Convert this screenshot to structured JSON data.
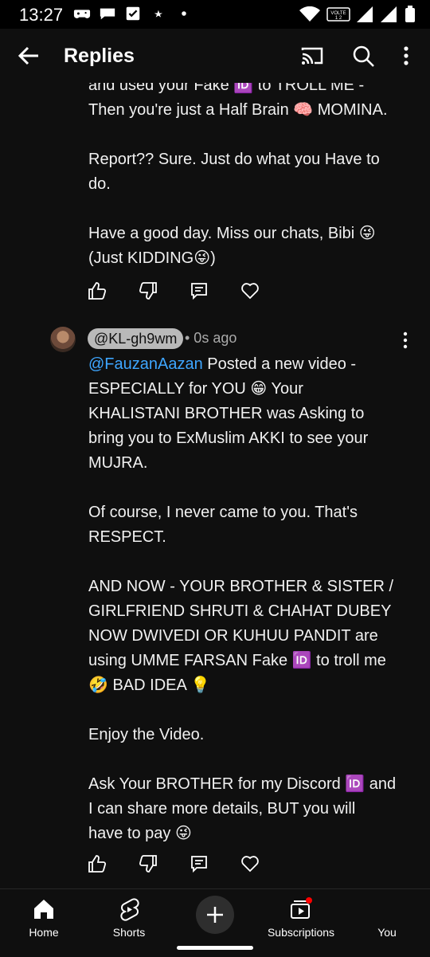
{
  "status": {
    "time": "13:27",
    "volte": "VOLTE"
  },
  "header": {
    "title": "Replies"
  },
  "parent_comment": {
    "text": "and used your Fake 🆔 to TROLL ME -\nThen you're just a Half Brain 🧠 MOMINA.\n\nReport?? Sure. Just do what you Have to\ndo.\n\nHave a good day. Miss our chats, Bibi 😜\n(Just KIDDING😜)"
  },
  "reply": {
    "author": "@KL-gh9wm",
    "time_ago": "• 0s ago",
    "mention": "@FauzanAazan",
    "text_after_mention": " Posted a new video -\nESPECIALLY for YOU 😁 Your\nKHALISTANI BROTHER was Asking to\nbring you to ExMuslim AKKI to see your\nMUJRA.\n\nOf course, I never came to you. That's\nRESPECT.\n\nAND NOW - YOUR BROTHER & SISTER /\nGIRLFRIEND SHRUTI & CHAHAT DUBEY\nNOW DWIVEDI OR KUHUU PANDIT are\nusing UMME FARSAN Fake 🆔 to troll me\n🤣 BAD IDEA 💡\n\nEnjoy the Video.\n\nAsk Your BROTHER for my Discord 🆔 and\nI can share more details, BUT you will\nhave to pay 😜"
  },
  "nav": {
    "home": "Home",
    "shorts": "Shorts",
    "subscriptions": "Subscriptions",
    "you": "You"
  },
  "colors": {
    "background": "#0f0f0f",
    "mention": "#3ea6ff",
    "badge": "#ff0000"
  }
}
